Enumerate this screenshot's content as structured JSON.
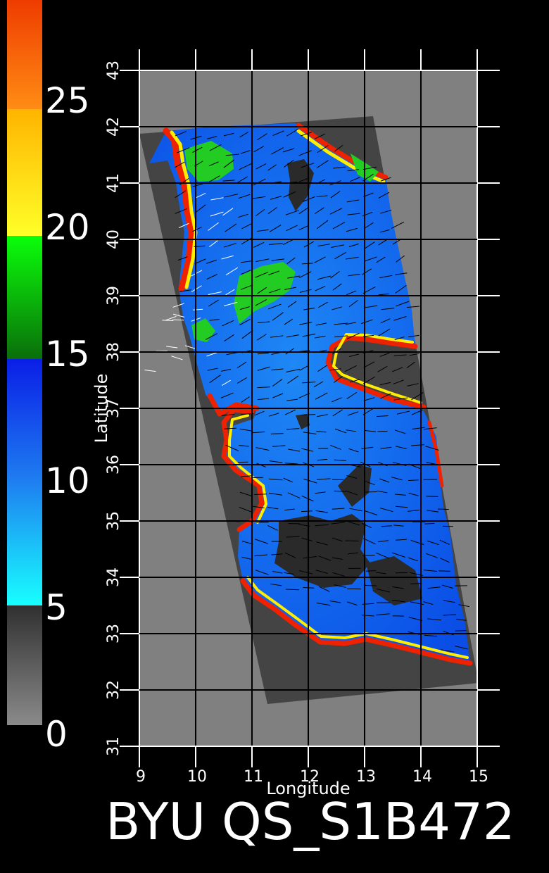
{
  "colorbar": {
    "tick_labels": [
      "0",
      "5",
      "10",
      "15",
      "20",
      "25"
    ],
    "segments": [
      {
        "from": 0,
        "to": 5,
        "colors": [
          "#8a8a8a",
          "#303030"
        ]
      },
      {
        "from": 5,
        "to": 10,
        "colors": [
          "#18ffff",
          "#1e7cf0"
        ]
      },
      {
        "from": 10,
        "to": 15,
        "colors": [
          "#1e7cf0",
          "#0a1ee6"
        ]
      },
      {
        "from": 15,
        "to": 20,
        "colors": [
          "#0a6e0a",
          "#0aff0a"
        ]
      },
      {
        "from": 20,
        "to": 25,
        "colors": [
          "#ffff28",
          "#ffb400"
        ]
      },
      {
        "from": 25,
        "to": 28,
        "colors": [
          "#ff8c14",
          "#ee3c00"
        ]
      }
    ]
  },
  "map": {
    "xlabel": "Longitude",
    "ylabel": "Latitude",
    "x_ticks": [
      "9",
      "10",
      "11",
      "12",
      "13",
      "14",
      "15"
    ],
    "y_ticks": [
      "31",
      "32",
      "33",
      "34",
      "35",
      "36",
      "37",
      "38",
      "39",
      "40",
      "41",
      "42",
      "43"
    ],
    "lon_range": [
      9,
      15
    ],
    "lat_range": [
      31,
      43
    ],
    "grid": true,
    "colors": {
      "background": "#000000",
      "no_data": "#808080",
      "land": "#444444",
      "ocean_low": "#1e90ff",
      "ocean_high": "#0a40e6",
      "calm": "#2a2a2a",
      "moderate": "#22cc22",
      "coast_yellow": "#ffee00",
      "coast_red": "#ee2200",
      "wind_vector": "#000000",
      "rain_flag_vector": "#ffffff"
    },
    "swath_corners_lonlat": [
      [
        9.0,
        41.92
      ],
      [
        13.2,
        42.2
      ],
      [
        15.0,
        32.4
      ],
      [
        11.2,
        31.8
      ]
    ]
  },
  "footer": {
    "title": "BYU QS_S1B472"
  }
}
